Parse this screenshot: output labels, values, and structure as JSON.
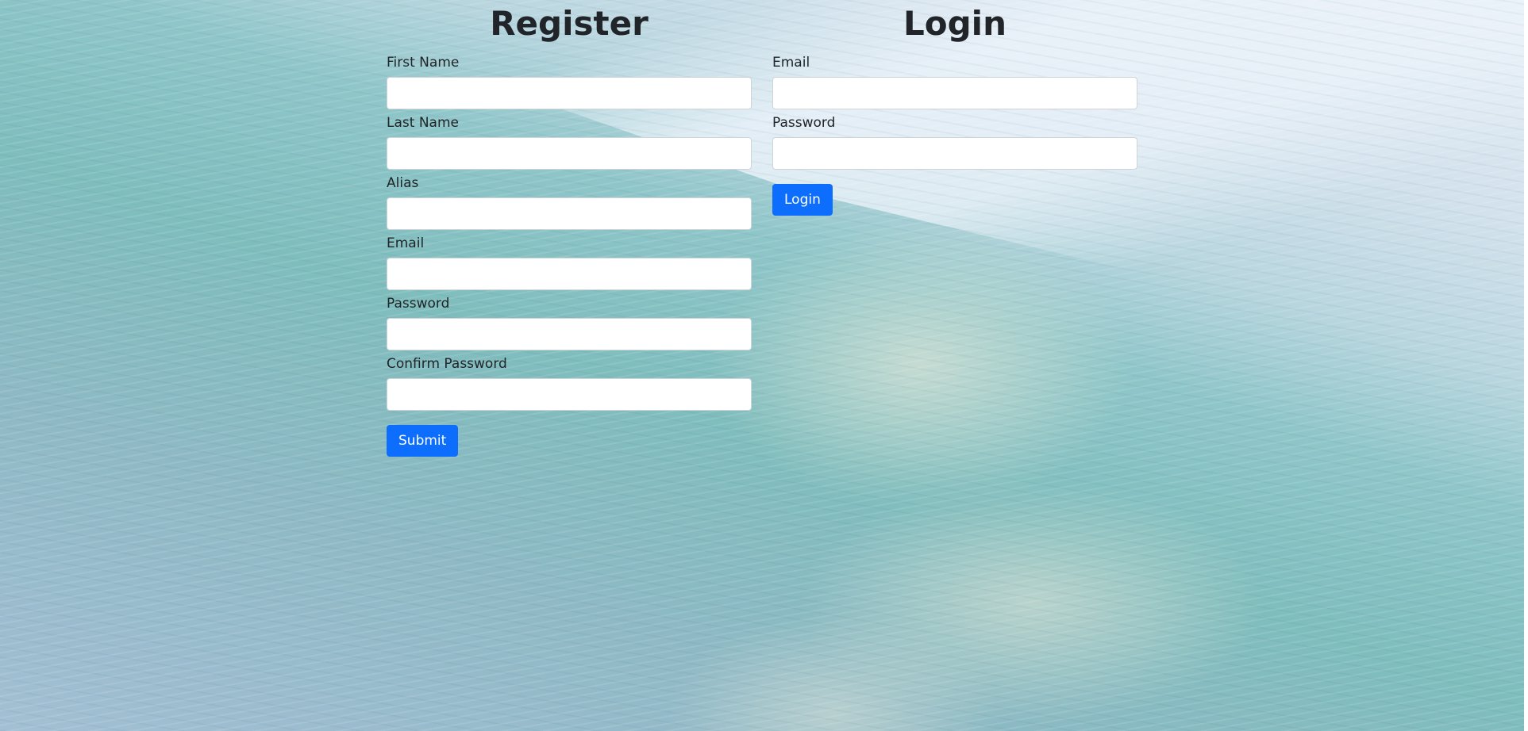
{
  "register": {
    "title": "Register",
    "fields": [
      {
        "label": "First Name",
        "value": "",
        "type": "text"
      },
      {
        "label": "Last Name",
        "value": "",
        "type": "text"
      },
      {
        "label": "Alias",
        "value": "",
        "type": "text"
      },
      {
        "label": "Email",
        "value": "",
        "type": "email"
      },
      {
        "label": "Password",
        "value": "",
        "type": "password"
      },
      {
        "label": "Confirm Password",
        "value": "",
        "type": "password"
      }
    ],
    "submit_label": "Submit"
  },
  "login": {
    "title": "Login",
    "fields": [
      {
        "label": "Email",
        "value": "",
        "type": "email"
      },
      {
        "label": "Password",
        "value": "",
        "type": "password"
      }
    ],
    "submit_label": "Login"
  },
  "colors": {
    "primary_button": "#0d6efd",
    "heading_text": "#212529",
    "background_theme": "ocean-water"
  }
}
